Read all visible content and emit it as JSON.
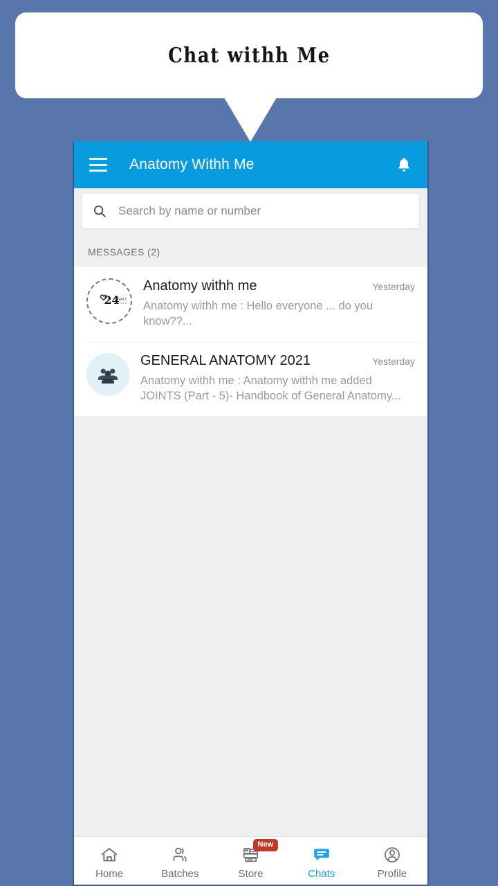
{
  "callout": {
    "title": "Chat withh Me"
  },
  "appbar": {
    "menu_icon": "hamburger-menu-icon",
    "title": "Anatomy Withh Me",
    "notification_icon": "bell-icon"
  },
  "search": {
    "icon": "search-icon",
    "placeholder": "Search by name or number",
    "value": ""
  },
  "messages_section": {
    "header": "MESSAGES (2)",
    "count": 2
  },
  "chats": [
    {
      "avatar_type": "logo-dashed-circle",
      "avatar_text": "24",
      "avatar_sub": "ANATOMY",
      "name": "Anatomy withh me",
      "time": "Yesterday",
      "preview": "Anatomy withh me :  Hello everyone ... do you know??..."
    },
    {
      "avatar_type": "group-icon",
      "name": "GENERAL ANATOMY 2021",
      "time": "Yesterday",
      "preview": "Anatomy withh me :  Anatomy withh me added JOINTS (Part - 5)- Handbook of General Anatomy..."
    }
  ],
  "bottom_nav": {
    "items": [
      {
        "label": "Home",
        "icon": "home-icon",
        "active": false,
        "badge": ""
      },
      {
        "label": "Batches",
        "icon": "batches-icon",
        "active": false,
        "badge": ""
      },
      {
        "label": "Store",
        "icon": "store-icon",
        "active": false,
        "badge": "New"
      },
      {
        "label": "Chats",
        "icon": "chats-icon",
        "active": true,
        "badge": ""
      },
      {
        "label": "Profile",
        "icon": "profile-icon",
        "active": false,
        "badge": ""
      }
    ]
  },
  "colors": {
    "page_background": "#5875ac",
    "appbar_blue": "#089bdd",
    "accent_blue": "#1c9fd4",
    "badge_red": "#c0392b",
    "surface_gray": "#efefef"
  }
}
